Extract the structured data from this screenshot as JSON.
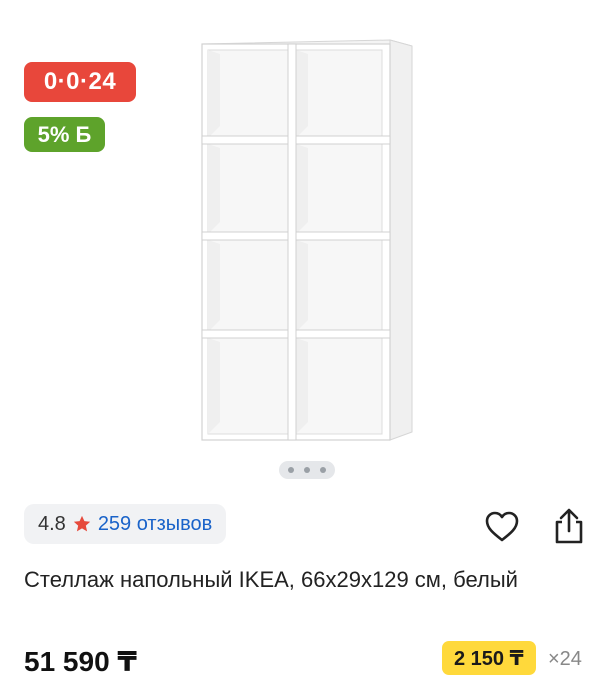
{
  "badges": {
    "installment": "0·0·24",
    "bonus": "5% Б"
  },
  "gallery": {
    "image_alt": "white shelving unit",
    "slide_count": 3,
    "active_slide": 1
  },
  "rating": {
    "value": "4.8",
    "reviews": "259 отзывов"
  },
  "product": {
    "title": "Стеллаж напольный IKEA, 66x29x129 см, белый",
    "price": "51 590 ₸"
  },
  "installment": {
    "monthly": "2 150 ₸",
    "months": "×24"
  },
  "colors": {
    "installment_badge": "#e8473b",
    "bonus_badge": "#5ea32b",
    "star": "#e64a3c",
    "link": "#1a63c9",
    "monthly_bg": "#ffd93b"
  },
  "icons": {
    "favorite": "heart-icon",
    "share": "share-icon",
    "rating": "star-icon"
  }
}
